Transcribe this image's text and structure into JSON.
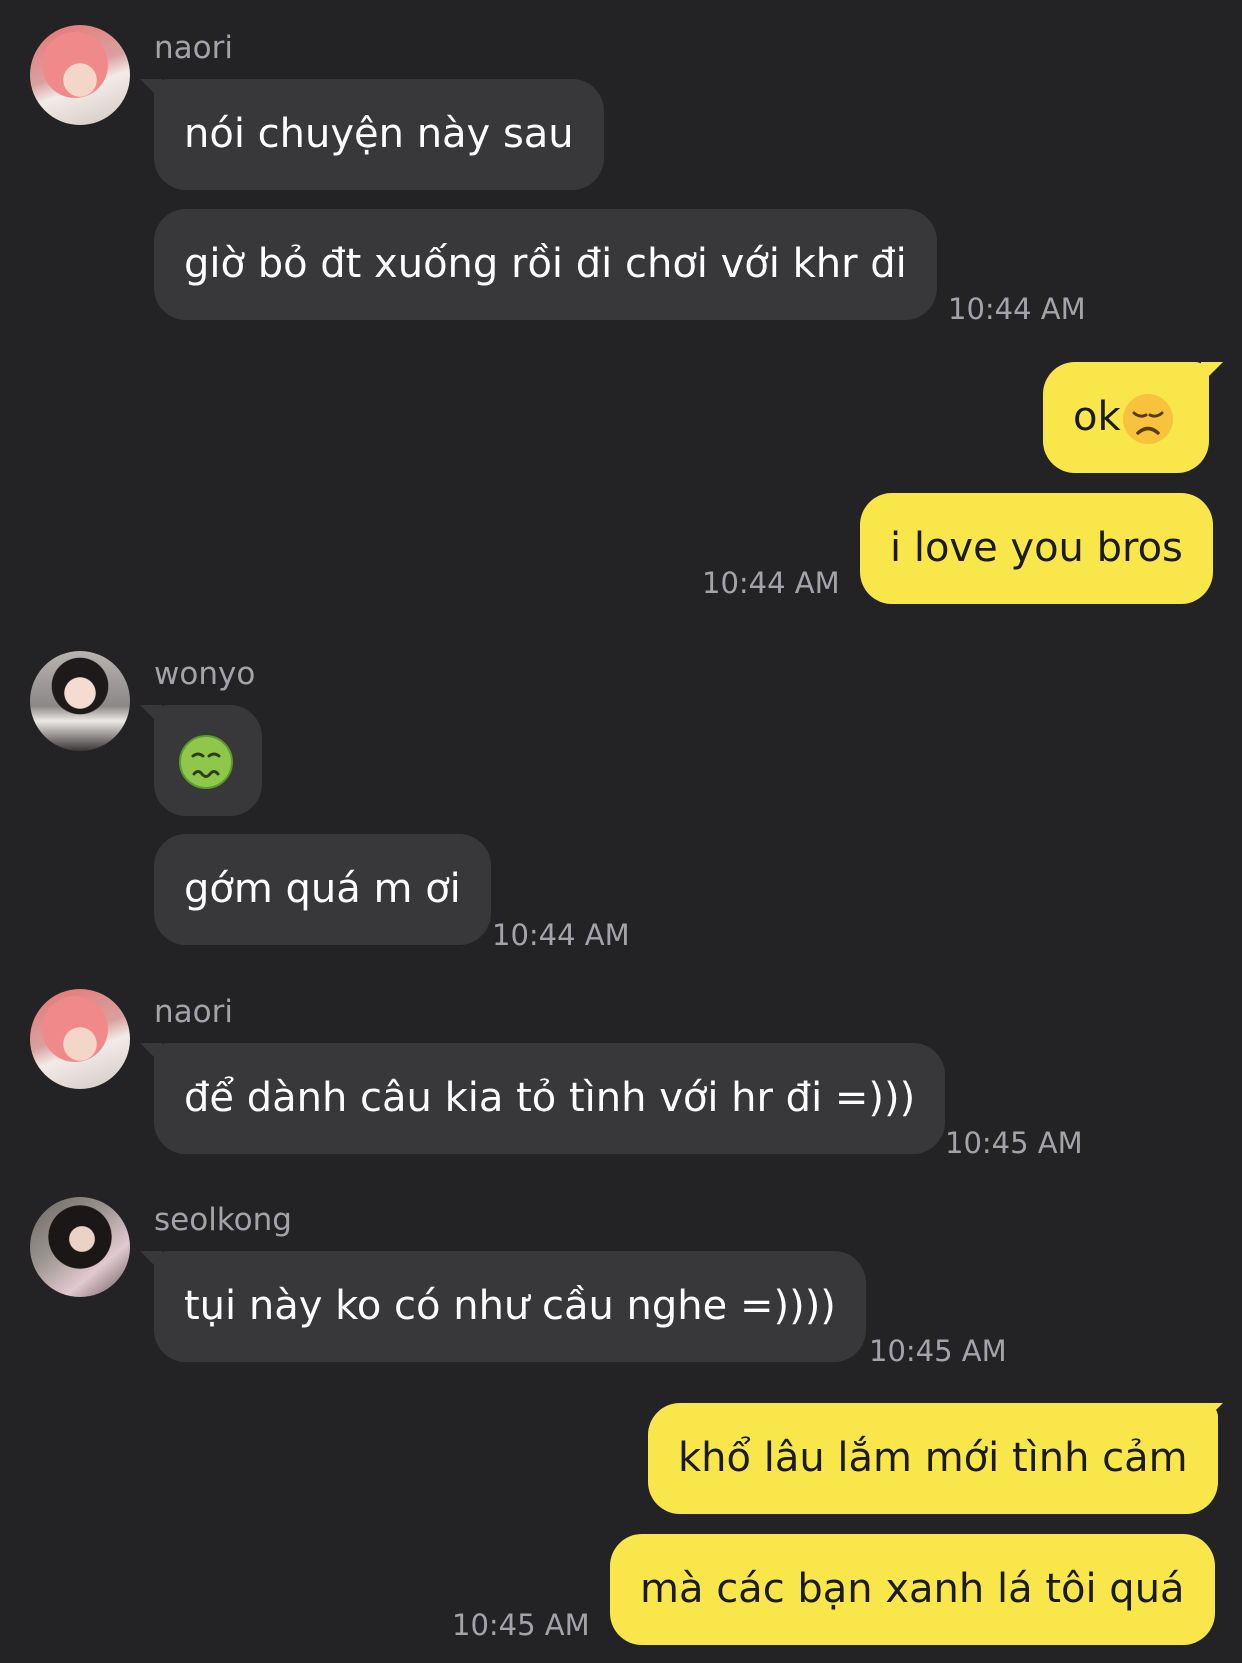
{
  "messages": [
    {
      "sender": "naori",
      "avatar": "naori-avatar",
      "texts": [
        "nói chuyện này sau",
        "giờ bỏ đt xuống rồi đi chơi với khr đi"
      ],
      "time": "10:44 AM"
    },
    {
      "sender": "me",
      "texts": [
        "ok",
        "i love you bros"
      ],
      "emoji": "disappointed-face-icon",
      "time": "10:44 AM"
    },
    {
      "sender": "wonyo",
      "avatar": "wonyo-avatar",
      "texts": [
        "",
        "gớm quá m ơi"
      ],
      "emoji": "nauseated-face-icon",
      "time": "10:44 AM"
    },
    {
      "sender": "naori",
      "avatar": "naori-avatar",
      "texts": [
        "để dành câu kia tỏ tình với hr đi =)))"
      ],
      "time": "10:45 AM"
    },
    {
      "sender": "seolkong",
      "avatar": "seolkong-avatar",
      "texts": [
        "tụi này ko có như cầu nghe =))))"
      ],
      "time": "10:45 AM"
    },
    {
      "sender": "me",
      "texts": [
        "khổ lâu lắm mới tình cảm",
        "mà các bạn xanh lá tôi quá"
      ],
      "time": "10:45 AM"
    }
  ],
  "colors": {
    "background": "#232325",
    "incoming_bubble": "#38383a",
    "outgoing_bubble": "#f9e64a",
    "meta_text": "#a4a4a8"
  }
}
